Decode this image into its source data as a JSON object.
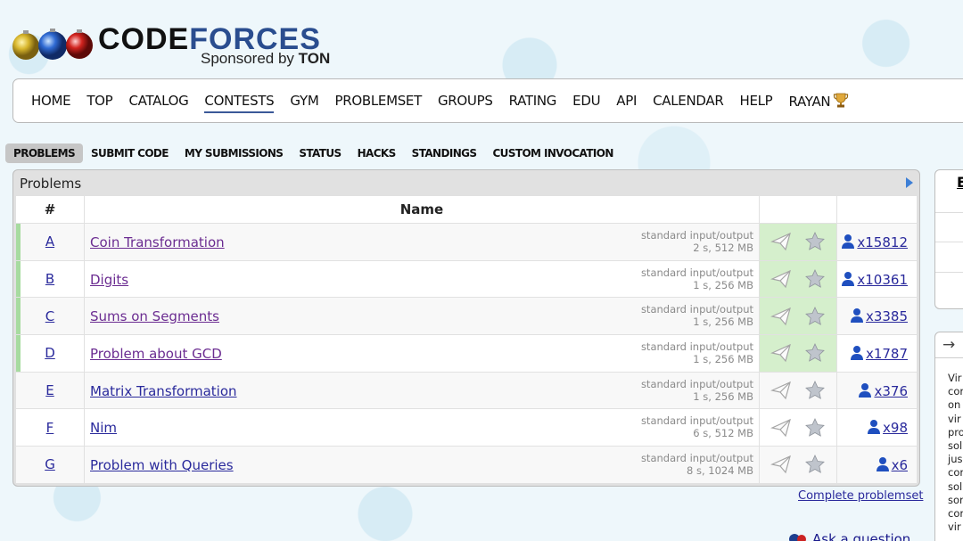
{
  "brand": {
    "word1": "CODE",
    "word2": "FORCES",
    "sponsor_prefix": "Sponsored by ",
    "sponsor_name": "TON"
  },
  "menu": {
    "items": [
      "HOME",
      "TOP",
      "CATALOG",
      "CONTESTS",
      "GYM",
      "PROBLEMSET",
      "GROUPS",
      "RATING",
      "EDU",
      "API",
      "CALENDAR",
      "HELP"
    ],
    "user": "RAYAN",
    "active": "CONTESTS"
  },
  "submenu": [
    "PROBLEMS",
    "SUBMIT CODE",
    "MY SUBMISSIONS",
    "STATUS",
    "HACKS",
    "STANDINGS",
    "CUSTOM INVOCATION"
  ],
  "problems_box": {
    "title": "Problems",
    "columns": {
      "index": "#",
      "name": "Name"
    },
    "rows": [
      {
        "index": "A",
        "name": "Coin Transformation",
        "io": "standard input/output",
        "limits": "2 s, 512 MB",
        "solved": "x15812"
      },
      {
        "index": "B",
        "name": "Digits",
        "io": "standard input/output",
        "limits": "1 s, 256 MB",
        "solved": "x10361"
      },
      {
        "index": "C",
        "name": "Sums on Segments",
        "io": "standard input/output",
        "limits": "1 s, 256 MB",
        "solved": "x3385"
      },
      {
        "index": "D",
        "name": "Problem about GCD",
        "io": "standard input/output",
        "limits": "1 s, 256 MB",
        "solved": "x1787"
      },
      {
        "index": "E",
        "name": "Matrix Transformation",
        "io": "standard input/output",
        "limits": "1 s, 256 MB",
        "solved": "x376"
      },
      {
        "index": "F",
        "name": "Nim",
        "io": "standard input/output",
        "limits": "6 s, 512 MB",
        "solved": "x98"
      },
      {
        "index": "G",
        "name": "Problem with Queries",
        "io": "standard input/output",
        "limits": "8 s, 1024 MB",
        "solved": "x6"
      }
    ],
    "complete_link": "Complete problemset"
  },
  "side": {
    "box1_fragment": "E",
    "box2_arrow": "→",
    "box2_lines": [
      "Vir",
      "cor",
      "on",
      "vir",
      "pro",
      "sol",
      "jus",
      "cor",
      "sol",
      "sor",
      "cor",
      "vir"
    ]
  },
  "ask": "Ask a question",
  "colors": {
    "accent": "#3b5998",
    "accepted": "#d5efcc",
    "accepted_bar": "#a7dba0",
    "link": "#2a2a9c",
    "visited": "#6b2c91"
  }
}
